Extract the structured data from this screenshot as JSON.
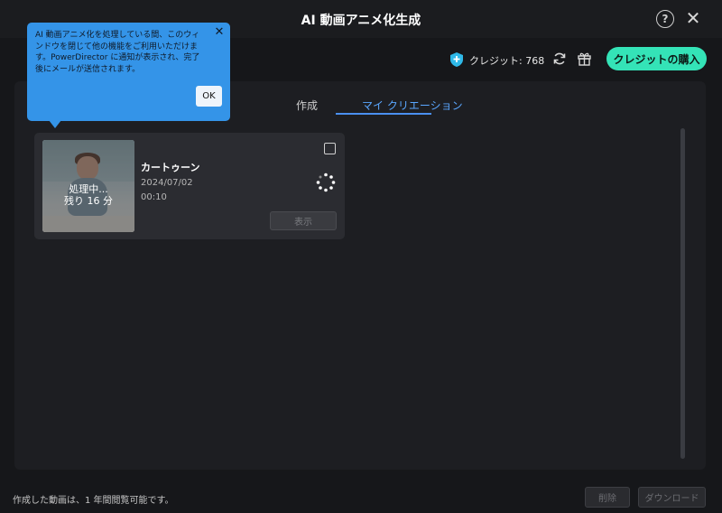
{
  "window": {
    "title": "AI 動画アニメ化生成",
    "help_icon": "question-circle-icon",
    "close_icon": "close-icon",
    "help_glyph": "?",
    "close_glyph": "✕"
  },
  "topbar": {
    "credit_icon": "credit-shield-icon",
    "credits_label": "クレジット: 768",
    "refresh_icon": "refresh-icon",
    "gift_icon": "gift-icon",
    "buy_button": "クレジットの購入",
    "buy_color": "#34e3b7"
  },
  "tabs": [
    {
      "label": "作成",
      "active": false
    },
    {
      "label": "マイ クリエーション",
      "active": true
    }
  ],
  "tooltip": {
    "text": "AI 動画アニメ化を処理している間、このウィンドウを閉じて他の機能をご利用いただけます。PowerDirector に通知が表示され、完了後にメールが送信されます。",
    "ok_button": "OK",
    "close_glyph": "✕",
    "color": "#3494e8"
  },
  "creations": [
    {
      "status_text": "処理中...",
      "remaining_text": "残り 16 分",
      "style_name": "カートゥーン",
      "date": "2024/07/02",
      "duration": "00:10",
      "view_button": "表示"
    }
  ],
  "footer": {
    "note": "作成した動画は、1 年間閲覧可能です。",
    "delete_button": "削除",
    "download_button": "ダウンロード"
  },
  "accent_color": "#4a8ff0"
}
